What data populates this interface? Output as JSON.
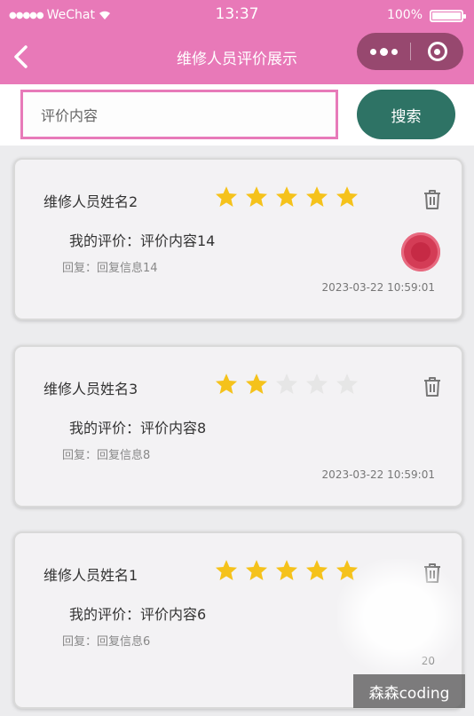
{
  "status_bar": {
    "carrier": "WeChat",
    "time": "13:37",
    "battery": "100%"
  },
  "nav": {
    "title": "维修人员评价展示"
  },
  "search": {
    "placeholder": "评价内容",
    "button_label": "搜索"
  },
  "colors": {
    "nav_bg": "#e879b8",
    "search_border": "#e77ab9",
    "search_button": "#2e7365",
    "star_active": "#f5c21b",
    "star_inactive": "#e6e6e6"
  },
  "reviews": [
    {
      "name": "维修人员姓名2",
      "rating": 5,
      "comment": "我的评价：评价内容14",
      "reply": "回复：回复信息14",
      "time": "2023-03-22 10:59:01",
      "has_badge": true
    },
    {
      "name": "维修人员姓名3",
      "rating": 2,
      "comment": "我的评价：评价内容8",
      "reply": "回复：回复信息8",
      "time": "2023-03-22 10:59:01",
      "has_badge": false
    },
    {
      "name": "维修人员姓名1",
      "rating": 5,
      "comment": "我的评价：评价内容6",
      "reply": "回复：回复信息6",
      "time": "20",
      "has_badge": false
    }
  ],
  "watermark": "森森coding"
}
